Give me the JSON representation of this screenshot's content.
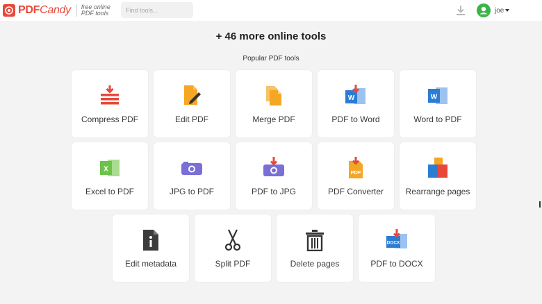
{
  "header": {
    "logo": {
      "brand_pdf": "PDF",
      "brand_candy": "Candy",
      "tagline_1": "free online",
      "tagline_2": "PDF tools"
    },
    "search": {
      "placeholder": "Find tools..."
    },
    "download_icon": "download-icon",
    "user": {
      "name": "joe",
      "avatar_icon": "user-icon"
    }
  },
  "main": {
    "title": "+ 46 more online tools",
    "subtitle": "Popular PDF tools",
    "tools": [
      {
        "label": "Compress PDF",
        "icon": "compress-icon"
      },
      {
        "label": "Edit PDF",
        "icon": "edit-pdf-icon"
      },
      {
        "label": "Merge PDF",
        "icon": "merge-icon"
      },
      {
        "label": "PDF to Word",
        "icon": "pdf-to-word-icon"
      },
      {
        "label": "Word to PDF",
        "icon": "word-to-pdf-icon"
      },
      {
        "label": "Excel to PDF",
        "icon": "excel-icon"
      },
      {
        "label": "JPG to PDF",
        "icon": "jpg-icon"
      },
      {
        "label": "PDF to JPG",
        "icon": "pdf-to-jpg-icon"
      },
      {
        "label": "PDF Converter",
        "icon": "pdf-converter-icon"
      },
      {
        "label": "Rearrange pages",
        "icon": "rearrange-icon"
      },
      {
        "label": "Edit metadata",
        "icon": "info-icon"
      },
      {
        "label": "Split PDF",
        "icon": "scissors-icon"
      },
      {
        "label": "Delete pages",
        "icon": "trash-icon"
      },
      {
        "label": "PDF to DOCX",
        "icon": "pdf-to-docx-icon"
      }
    ]
  },
  "colors": {
    "brand_red": "#e8483a",
    "orange": "#f5a623",
    "word_blue": "#2b7cd3",
    "excel_green": "#6cc24a",
    "purple": "#7a6fd6",
    "avatar_green": "#3cb34a"
  }
}
